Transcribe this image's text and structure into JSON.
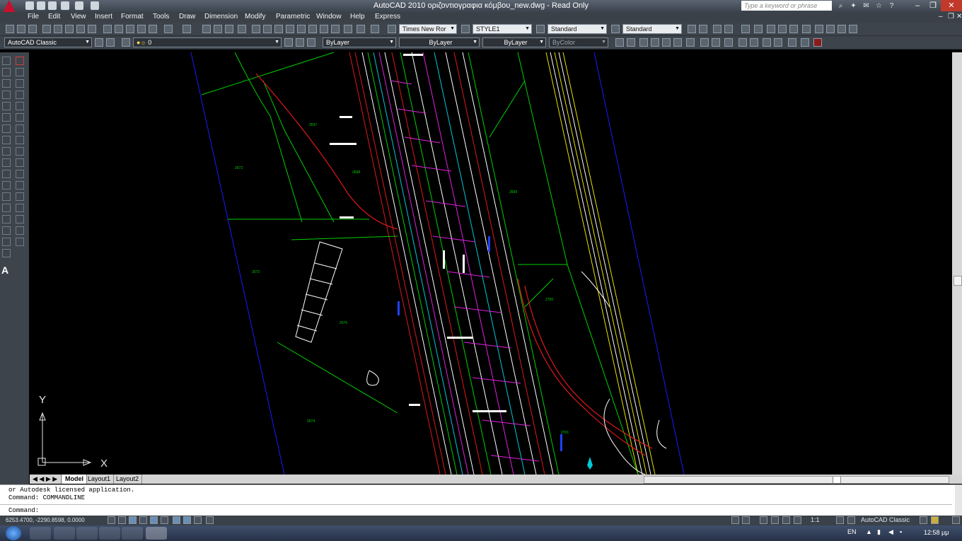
{
  "titlebar": {
    "title": "AutoCAD 2010     οριζοντιογραφια κόμβου_new.dwg - Read Only",
    "search_placeholder": "Type a keyword or phrase"
  },
  "menu": [
    "File",
    "Edit",
    "View",
    "Insert",
    "Format",
    "Tools",
    "Draw",
    "Dimension",
    "Modify",
    "Parametric",
    "Window",
    "Help",
    "Express"
  ],
  "toolbar_styles": {
    "text_style": "Times New Ror",
    "dim_style": "STYLE1",
    "table_style": "Standard",
    "multileader_style": "Standard"
  },
  "toolbar_layers": {
    "workspace": "AutoCAD Classic",
    "layer": "0",
    "color": "ByLayer",
    "linetype": "ByLayer",
    "lineweight": "ByLayer",
    "plotstyle": "ByColor"
  },
  "drawing": {
    "parcel_labels": [
      "2697",
      "2672",
      "2698",
      "2699",
      "2673",
      "2700",
      "2676",
      "2674",
      "2701"
    ],
    "ucs_y": "Y",
    "ucs_x": "X"
  },
  "tabs": [
    "Model",
    "Layout1",
    "Layout2"
  ],
  "command": {
    "line1": "or Autodesk licensed application.",
    "line2": "Command: COMMANDLINE",
    "prompt": "Command:"
  },
  "status": {
    "coordinates": "6253.4700, -2290.8598, 0.0000",
    "annotation_scale": "1:1",
    "workspace": "AutoCAD Classic"
  },
  "taskbar": {
    "language": "EN",
    "clock": "12:58 μμ"
  },
  "colors": {
    "green": "#00d000",
    "red": "#e0181a",
    "blue": "#0000e0",
    "cyan": "#00c8d8",
    "magenta": "#e020e0",
    "yellow": "#e8e000",
    "white": "#ffffff"
  }
}
